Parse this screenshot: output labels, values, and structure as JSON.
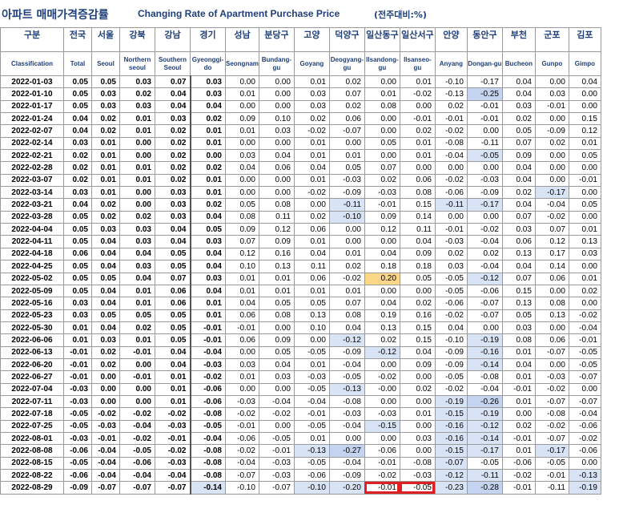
{
  "title": {
    "korean": "아파트 매매가격증감률",
    "english": "Changing Rate of Apartment Purchase Price",
    "unit": "(전주대비:%)"
  },
  "columns": [
    {
      "ko": "구분",
      "en": "Classification"
    },
    {
      "ko": "전국",
      "en": "Total"
    },
    {
      "ko": "서울",
      "en": "Seoul"
    },
    {
      "ko": "강북",
      "en": "Northern seoul"
    },
    {
      "ko": "강남",
      "en": "Southern Seoul"
    },
    {
      "ko": "경기",
      "en": "Gyeonggi-do"
    },
    {
      "ko": "성남",
      "en": "Seongnam"
    },
    {
      "ko": "분당구",
      "en": "Bundang-gu"
    },
    {
      "ko": "고양",
      "en": "Goyang"
    },
    {
      "ko": "덕양구",
      "en": "Deogyang-gu"
    },
    {
      "ko": "일산동구",
      "en": "Ilsandong-gu"
    },
    {
      "ko": "일산서구",
      "en": "Ilsanseo-gu"
    },
    {
      "ko": "안양",
      "en": "Anyang"
    },
    {
      "ko": "동안구",
      "en": "Dongan-gu"
    },
    {
      "ko": "부천",
      "en": "Bucheon"
    },
    {
      "ko": "군포",
      "en": "Gunpo"
    },
    {
      "ko": "김포",
      "en": "Gimpo"
    }
  ],
  "rows": [
    [
      "2022-01-03",
      "0.05",
      "0.05",
      "0.03",
      "0.07",
      "0.03",
      "0.00",
      "0.00",
      "0.01",
      "0.02",
      "0.00",
      "0.01",
      "-0.10",
      "-0.17",
      "0.04",
      "0.00",
      "0.04"
    ],
    [
      "2022-01-10",
      "0.05",
      "0.03",
      "0.02",
      "0.04",
      "0.03",
      "0.01",
      "0.00",
      "0.03",
      "0.07",
      "0.01",
      "-0.02",
      "-0.13",
      "-0.25",
      "0.04",
      "0.03",
      "0.00"
    ],
    [
      "2022-01-17",
      "0.05",
      "0.03",
      "0.03",
      "0.04",
      "0.04",
      "0.00",
      "0.00",
      "0.03",
      "0.02",
      "0.08",
      "0.00",
      "0.02",
      "-0.01",
      "0.03",
      "-0.01",
      "0.00"
    ],
    [
      "2022-01-24",
      "0.04",
      "0.02",
      "0.01",
      "0.03",
      "0.02",
      "0.09",
      "0.10",
      "0.02",
      "0.06",
      "0.00",
      "-0.01",
      "-0.01",
      "-0.01",
      "0.02",
      "0.00",
      "0.15"
    ],
    [
      "2022-02-07",
      "0.04",
      "0.02",
      "0.01",
      "0.02",
      "0.01",
      "0.01",
      "0.03",
      "-0.02",
      "-0.07",
      "0.00",
      "0.02",
      "-0.02",
      "0.00",
      "0.05",
      "-0.09",
      "0.12"
    ],
    [
      "2022-02-14",
      "0.03",
      "0.01",
      "0.00",
      "0.02",
      "0.01",
      "0.00",
      "0.00",
      "0.01",
      "0.00",
      "0.05",
      "0.01",
      "-0.08",
      "-0.11",
      "0.07",
      "0.02",
      "0.01"
    ],
    [
      "2022-02-21",
      "0.02",
      "0.01",
      "0.00",
      "0.02",
      "0.00",
      "0.03",
      "0.04",
      "0.01",
      "0.01",
      "0.00",
      "0.01",
      "-0.04",
      "-0.05",
      "0.09",
      "0.00",
      "0.05"
    ],
    [
      "2022-02-28",
      "0.02",
      "0.01",
      "0.01",
      "0.02",
      "0.02",
      "0.04",
      "0.06",
      "0.04",
      "0.05",
      "0.07",
      "0.00",
      "0.00",
      "0.00",
      "0.04",
      "0.00",
      "0.00"
    ],
    [
      "2022-03-07",
      "0.02",
      "0.01",
      "0.01",
      "0.02",
      "0.01",
      "0.00",
      "0.00",
      "0.01",
      "-0.03",
      "0.02",
      "0.06",
      "-0.02",
      "-0.03",
      "0.04",
      "0.00",
      "-0.01"
    ],
    [
      "2022-03-14",
      "0.03",
      "0.01",
      "0.00",
      "0.03",
      "0.01",
      "0.00",
      "0.00",
      "-0.02",
      "-0.09",
      "-0.03",
      "0.08",
      "-0.06",
      "-0.09",
      "0.02",
      "-0.17",
      "0.00"
    ],
    [
      "2022-03-21",
      "0.04",
      "0.02",
      "0.00",
      "0.03",
      "0.02",
      "0.05",
      "0.08",
      "0.00",
      "-0.11",
      "-0.01",
      "0.15",
      "-0.11",
      "-0.17",
      "0.04",
      "-0.04",
      "0.05"
    ],
    [
      "2022-03-28",
      "0.05",
      "0.02",
      "0.02",
      "0.03",
      "0.04",
      "0.08",
      "0.11",
      "0.02",
      "-0.10",
      "0.09",
      "0.14",
      "0.00",
      "0.00",
      "0.07",
      "-0.02",
      "0.00"
    ],
    [
      "2022-04-04",
      "0.05",
      "0.03",
      "0.03",
      "0.04",
      "0.05",
      "0.09",
      "0.12",
      "0.06",
      "0.00",
      "0.12",
      "0.11",
      "-0.01",
      "-0.02",
      "0.03",
      "0.07",
      "0.01"
    ],
    [
      "2022-04-11",
      "0.05",
      "0.04",
      "0.03",
      "0.04",
      "0.03",
      "0.07",
      "0.09",
      "0.01",
      "0.00",
      "0.00",
      "0.04",
      "-0.03",
      "-0.04",
      "0.06",
      "0.12",
      "0.13"
    ],
    [
      "2022-04-18",
      "0.06",
      "0.04",
      "0.04",
      "0.05",
      "0.04",
      "0.12",
      "0.16",
      "0.04",
      "0.01",
      "0.04",
      "0.09",
      "0.02",
      "0.02",
      "0.13",
      "0.17",
      "0.03"
    ],
    [
      "2022-04-25",
      "0.05",
      "0.04",
      "0.03",
      "0.05",
      "0.04",
      "0.10",
      "0.13",
      "0.11",
      "0.02",
      "0.18",
      "0.18",
      "0.03",
      "-0.04",
      "0.04",
      "0.14",
      "0.00"
    ],
    [
      "2022-05-02",
      "0.05",
      "0.05",
      "0.04",
      "0.07",
      "0.03",
      "0.01",
      "0.01",
      "0.06",
      "-0.02",
      "0.20",
      "0.05",
      "-0.05",
      "-0.12",
      "0.07",
      "0.06",
      "0.01"
    ],
    [
      "2022-05-09",
      "0.05",
      "0.04",
      "0.01",
      "0.06",
      "0.04",
      "0.01",
      "0.01",
      "0.01",
      "0.01",
      "0.00",
      "0.00",
      "-0.05",
      "-0.06",
      "0.15",
      "0.00",
      "0.02"
    ],
    [
      "2022-05-16",
      "0.03",
      "0.04",
      "0.01",
      "0.06",
      "0.01",
      "0.04",
      "0.05",
      "0.05",
      "0.07",
      "0.04",
      "0.02",
      "-0.06",
      "-0.07",
      "0.13",
      "0.08",
      "0.00"
    ],
    [
      "2022-05-23",
      "0.03",
      "0.05",
      "0.05",
      "0.05",
      "0.01",
      "0.06",
      "0.08",
      "0.13",
      "0.08",
      "0.19",
      "0.16",
      "-0.02",
      "-0.07",
      "0.05",
      "0.13",
      "-0.02"
    ],
    [
      "2022-05-30",
      "0.01",
      "0.04",
      "0.02",
      "0.05",
      "-0.01",
      "-0.01",
      "0.00",
      "0.10",
      "0.04",
      "0.13",
      "0.15",
      "0.04",
      "0.00",
      "0.03",
      "0.00",
      "-0.04"
    ],
    [
      "2022-06-06",
      "0.01",
      "0.03",
      "0.01",
      "0.05",
      "-0.01",
      "0.06",
      "0.09",
      "0.00",
      "-0.12",
      "0.02",
      "0.15",
      "-0.10",
      "-0.19",
      "0.08",
      "0.06",
      "-0.01"
    ],
    [
      "2022-06-13",
      "-0.01",
      "0.02",
      "-0.01",
      "0.04",
      "-0.04",
      "0.00",
      "0.05",
      "-0.05",
      "-0.09",
      "-0.12",
      "0.04",
      "-0.09",
      "-0.16",
      "0.01",
      "-0.07",
      "-0.05"
    ],
    [
      "2022-06-20",
      "-0.01",
      "0.02",
      "0.00",
      "0.04",
      "-0.03",
      "0.03",
      "0.04",
      "0.01",
      "-0.04",
      "0.00",
      "0.09",
      "-0.09",
      "-0.14",
      "0.04",
      "0.00",
      "-0.05"
    ],
    [
      "2022-06-27",
      "-0.01",
      "0.00",
      "-0.01",
      "0.01",
      "-0.02",
      "0.01",
      "0.03",
      "-0.03",
      "-0.05",
      "-0.02",
      "0.00",
      "-0.05",
      "-0.08",
      "0.01",
      "-0.03",
      "-0.07"
    ],
    [
      "2022-07-04",
      "-0.03",
      "0.00",
      "0.00",
      "0.01",
      "-0.06",
      "0.00",
      "0.00",
      "-0.05",
      "-0.13",
      "-0.00",
      "0.02",
      "-0.02",
      "-0.04",
      "-0.01",
      "-0.02",
      "0.00"
    ],
    [
      "2022-07-11",
      "-0.03",
      "0.00",
      "0.00",
      "0.01",
      "-0.06",
      "-0.03",
      "-0.04",
      "-0.04",
      "-0.08",
      "0.00",
      "0.00",
      "-0.19",
      "-0.26",
      "0.01",
      "-0.07",
      "-0.07"
    ],
    [
      "2022-07-18",
      "-0.05",
      "-0.02",
      "-0.02",
      "-0.02",
      "-0.08",
      "-0.02",
      "-0.02",
      "-0.01",
      "-0.03",
      "-0.03",
      "0.01",
      "-0.15",
      "-0.19",
      "0.00",
      "-0.08",
      "-0.04"
    ],
    [
      "2022-07-25",
      "-0.05",
      "-0.03",
      "-0.04",
      "-0.03",
      "-0.05",
      "-0.01",
      "0.00",
      "-0.05",
      "-0.04",
      "-0.15",
      "0.00",
      "-0.16",
      "-0.12",
      "0.02",
      "-0.02",
      "-0.06"
    ],
    [
      "2022-08-01",
      "-0.03",
      "-0.01",
      "-0.02",
      "-0.01",
      "-0.04",
      "-0.06",
      "-0.05",
      "0.01",
      "0.00",
      "0.00",
      "0.03",
      "-0.16",
      "-0.14",
      "-0.01",
      "-0.07",
      "-0.02"
    ],
    [
      "2022-08-08",
      "-0.06",
      "-0.04",
      "-0.05",
      "-0.02",
      "-0.08",
      "-0.02",
      "-0.01",
      "-0.13",
      "-0.27",
      "-0.06",
      "0.00",
      "-0.15",
      "-0.17",
      "0.01",
      "-0.17",
      "-0.06"
    ],
    [
      "2022-08-15",
      "-0.05",
      "-0.04",
      "-0.06",
      "-0.03",
      "-0.08",
      "-0.04",
      "-0.03",
      "-0.05",
      "-0.04",
      "-0.01",
      "-0.08",
      "-0.07",
      "-0.05",
      "-0.06",
      "-0.05",
      "0.00"
    ],
    [
      "2022-08-22",
      "-0.06",
      "-0.04",
      "-0.04",
      "-0.04",
      "-0.08",
      "-0.07",
      "-0.03",
      "-0.06",
      "-0.09",
      "-0.02",
      "-0.03",
      "-0.12",
      "-0.11",
      "-0.02",
      "-0.01",
      "-0.13"
    ],
    [
      "2022-08-29",
      "-0.09",
      "-0.07",
      "-0.07",
      "-0.07",
      "-0.14",
      "-0.10",
      "-0.07",
      "-0.10",
      "-0.20",
      "-0.01",
      "-0.05",
      "-0.23",
      "-0.28",
      "-0.01",
      "-0.11",
      "-0.19"
    ]
  ],
  "highlights": {
    "blue": [
      [
        1,
        13
      ],
      [
        6,
        13
      ],
      [
        9,
        15
      ],
      [
        10,
        9
      ],
      [
        10,
        12
      ],
      [
        10,
        13
      ],
      [
        11,
        9
      ],
      [
        16,
        13
      ],
      [
        21,
        9
      ],
      [
        21,
        13
      ],
      [
        22,
        10
      ],
      [
        22,
        13
      ],
      [
        23,
        13
      ],
      [
        25,
        9
      ],
      [
        26,
        12
      ],
      [
        26,
        13
      ],
      [
        27,
        12
      ],
      [
        27,
        13
      ],
      [
        28,
        10
      ],
      [
        28,
        12
      ],
      [
        28,
        13
      ],
      [
        29,
        12
      ],
      [
        29,
        13
      ],
      [
        30,
        8
      ],
      [
        30,
        9
      ],
      [
        30,
        12
      ],
      [
        30,
        13
      ],
      [
        30,
        15
      ],
      [
        31,
        12
      ],
      [
        32,
        12
      ],
      [
        32,
        13
      ],
      [
        32,
        16
      ],
      [
        33,
        5
      ],
      [
        33,
        8
      ],
      [
        33,
        9
      ],
      [
        33,
        12
      ],
      [
        33,
        13
      ],
      [
        33,
        16
      ]
    ],
    "strong_blue": [
      [
        1,
        13
      ],
      [
        26,
        13
      ],
      [
        30,
        9
      ],
      [
        33,
        13
      ]
    ],
    "orange": [
      [
        16,
        10
      ]
    ],
    "red_boxes": [
      [
        33,
        10
      ],
      [
        33,
        11
      ]
    ]
  },
  "colors": {
    "header_text": "#1f3f7a",
    "highlight_blue": "#d9e3f6",
    "highlight_orange": "#fcd789",
    "red_box": "#e02020"
  }
}
